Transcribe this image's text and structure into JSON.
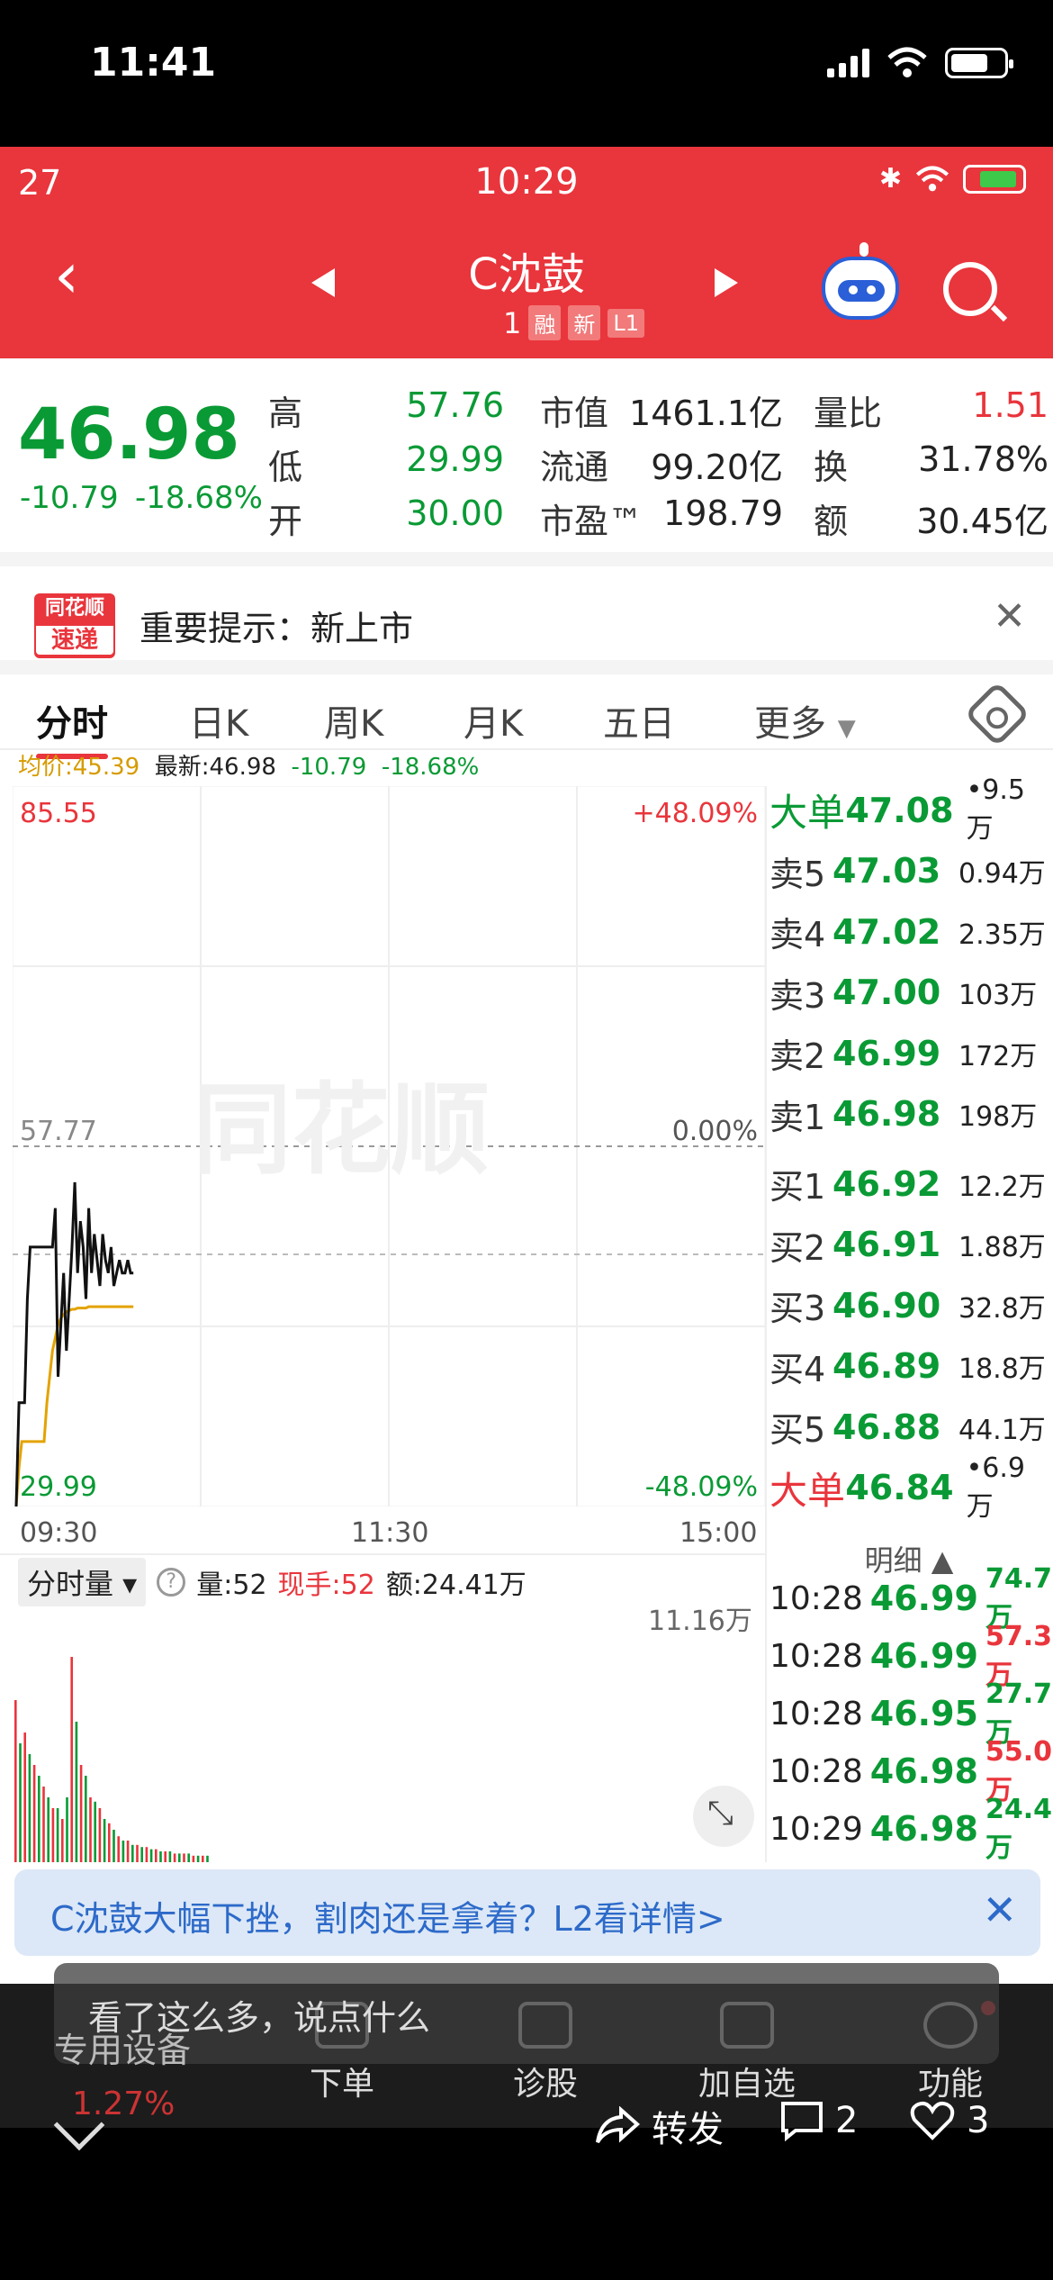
{
  "device": {
    "time": "11:41"
  },
  "inner_status": {
    "left": "27",
    "time": "10:29"
  },
  "header": {
    "stock_name": "C沈鼓",
    "code_suffix": "1",
    "tags": [
      "融",
      "新",
      "L1"
    ]
  },
  "quote": {
    "price": "46.98",
    "change": "-10.79",
    "change_pct": "-18.68%",
    "rows": [
      {
        "l1": "高",
        "v1": "57.76",
        "l2": "市值",
        "v2": "1461.1亿",
        "l3": "量比",
        "v3": "1.51"
      },
      {
        "l1": "低",
        "v1": "29.99",
        "l2": "流通",
        "v2": "99.20亿",
        "l3": "换",
        "v3": "31.78%"
      },
      {
        "l1": "开",
        "v1": "30.00",
        "l2": "市盈™",
        "v2": "198.79",
        "l3": "额",
        "v3": "30.45亿"
      }
    ]
  },
  "notice": {
    "logo_top": "同花顺",
    "logo_bottom": "速递",
    "text": "重要提示：新上市"
  },
  "tabs": [
    "分时",
    "日K",
    "周K",
    "月K",
    "五日",
    "更多"
  ],
  "avg_line": {
    "avg": "均价:45.39",
    "latest": "最新:46.98",
    "chg": "-10.79",
    "pct": "-18.68%"
  },
  "chart_data": {
    "type": "line",
    "y_top": "85.55",
    "y_mid": "57.77",
    "y_bottom": "29.99",
    "pct_top": "+48.09%",
    "pct_mid": "0.00%",
    "pct_bottom": "-48.09%",
    "x_ticks": [
      "09:30",
      "11:30",
      "15:00"
    ],
    "ylim": [
      29.99,
      85.55
    ],
    "price_series": [
      29.99,
      38,
      38,
      38,
      46,
      50,
      50,
      50,
      50,
      50,
      50,
      50,
      50,
      50,
      53,
      40,
      44,
      48,
      42,
      46,
      50,
      55,
      48,
      52,
      50,
      46,
      53,
      48,
      51,
      49,
      47,
      51,
      49,
      48,
      50,
      47,
      48,
      49,
      48,
      48,
      49,
      48,
      48
    ],
    "avg_series": [
      30,
      33,
      35,
      35,
      35,
      35,
      35,
      35,
      35,
      35,
      35,
      38,
      40,
      42,
      43,
      44,
      44.5,
      44.8,
      45,
      45.1,
      45.2,
      45.2,
      45.3,
      45.3,
      45.3,
      45.3,
      45.4,
      45.4,
      45.4,
      45.4,
      45.4,
      45.4,
      45.4,
      45.4,
      45.4,
      45.4,
      45.4,
      45.4,
      45.4,
      45.4,
      45.4,
      45.4,
      45.4
    ],
    "volume_series": [
      0.75,
      0.55,
      0.6,
      0.5,
      0.45,
      0.4,
      0.35,
      0.3,
      0.25,
      0.25,
      0.2,
      0.3,
      0.95,
      0.65,
      0.45,
      0.4,
      0.3,
      0.28,
      0.25,
      0.2,
      0.18,
      0.15,
      0.12,
      0.1,
      0.1,
      0.08,
      0.08,
      0.07,
      0.07,
      0.06,
      0.06,
      0.05,
      0.05,
      0.05,
      0.04,
      0.04,
      0.04,
      0.04,
      0.03,
      0.03,
      0.03,
      0.03
    ]
  },
  "order_book": [
    {
      "label": "大单",
      "price": "47.08",
      "vol": "•9.5万",
      "big": true
    },
    {
      "label": "卖5",
      "price": "47.03",
      "vol": "0.94万"
    },
    {
      "label": "卖4",
      "price": "47.02",
      "vol": "2.35万"
    },
    {
      "label": "卖3",
      "price": "47.00",
      "vol": "103万"
    },
    {
      "label": "卖2",
      "price": "46.99",
      "vol": "172万"
    },
    {
      "label": "卖1",
      "price": "46.98",
      "vol": "198万"
    },
    {
      "label": "买1",
      "price": "46.92",
      "vol": "12.2万"
    },
    {
      "label": "买2",
      "price": "46.91",
      "vol": "1.88万"
    },
    {
      "label": "买3",
      "price": "46.90",
      "vol": "32.8万"
    },
    {
      "label": "买4",
      "price": "46.89",
      "vol": "18.8万"
    },
    {
      "label": "买5",
      "price": "46.88",
      "vol": "44.1万"
    },
    {
      "label": "大单",
      "price": "46.84",
      "vol": "•6.9万",
      "big": true,
      "red": true
    }
  ],
  "detail_head": "明细 ▲",
  "details": [
    {
      "time": "10:28",
      "price": "46.99",
      "vol": "74.7万",
      "color": "#0a9a35"
    },
    {
      "time": "10:28",
      "price": "46.99",
      "vol": "57.3万",
      "color": "#e9353c"
    },
    {
      "time": "10:28",
      "price": "46.95",
      "vol": "27.7万",
      "color": "#0a9a35"
    },
    {
      "time": "10:28",
      "price": "46.98",
      "vol": "55.0万",
      "color": "#e9353c"
    },
    {
      "time": "10:29",
      "price": "46.98",
      "vol": "24.4万",
      "color": "#0a9a35"
    }
  ],
  "volume": {
    "selector": "分时量 ▾",
    "help": "?",
    "qty": "量:52",
    "hand": "现手:52",
    "amount": "额:24.41万",
    "max": "11.16万"
  },
  "banner": {
    "text": "C沈鼓大幅下挫，割肉还是拿着？L2看详情>",
    "close": "✕"
  },
  "bottom_nav": [
    "下单",
    "诊股",
    "加自选",
    "功能"
  ],
  "overlay": {
    "comment_placeholder": "看了这么多，说点什么",
    "device_label": "专用设备",
    "device_pct": "1.27%",
    "share": "转发",
    "comments": "2",
    "likes": "3"
  }
}
